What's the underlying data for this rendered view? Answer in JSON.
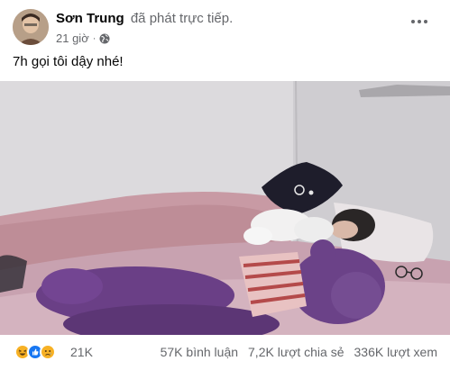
{
  "post": {
    "author": "Sơn Trung",
    "action": "đã phát trực tiếp.",
    "time": "21 giờ",
    "separator": "·",
    "privacy_icon": "globe-icon",
    "text": "7h gọi tôi dậy nhé!"
  },
  "video": {
    "description_icon": "live-video-frame"
  },
  "reactions": {
    "icons": [
      "haha-reaction-icon",
      "like-reaction-icon",
      "sad-reaction-icon"
    ],
    "count": "21K"
  },
  "stats": {
    "comments": "57K bình luận",
    "shares": "7,2K lượt chia sẻ",
    "views": "336K lượt xem"
  },
  "colors": {
    "text_primary": "#050505",
    "text_secondary": "#65676b",
    "like_blue": "#1877f2",
    "reaction_yellow": "#f7b125"
  }
}
